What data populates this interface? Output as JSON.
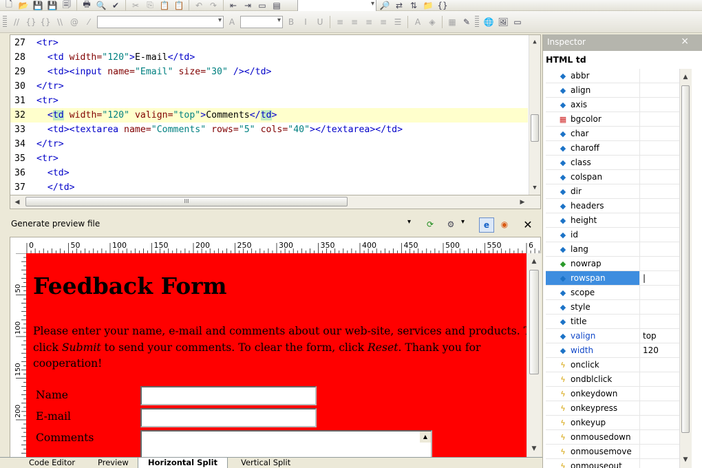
{
  "code_editor": {
    "lines": [
      {
        "num": "27",
        "parts": [
          [
            "tag",
            "<tr>"
          ]
        ]
      },
      {
        "num": "28",
        "parts": [
          [
            "txt",
            "  "
          ],
          [
            "tag",
            "<td "
          ],
          [
            "attr",
            "width="
          ],
          [
            "val",
            "\"120\""
          ],
          [
            "tag",
            ">"
          ],
          [
            "txt",
            "E-mail"
          ],
          [
            "tag",
            "</td>"
          ]
        ]
      },
      {
        "num": "29",
        "parts": [
          [
            "txt",
            "  "
          ],
          [
            "tag",
            "<td><input "
          ],
          [
            "attr",
            "name="
          ],
          [
            "val",
            "\"Email\" "
          ],
          [
            "attr",
            "size="
          ],
          [
            "val",
            "\"30\" "
          ],
          [
            "tag",
            "/></td>"
          ]
        ]
      },
      {
        "num": "30",
        "parts": [
          [
            "tag",
            "</tr>"
          ]
        ]
      },
      {
        "num": "31",
        "parts": [
          [
            "tag",
            "<tr>"
          ]
        ]
      },
      {
        "num": "32",
        "parts": [
          [
            "txt",
            "  "
          ],
          [
            "tag",
            "<"
          ],
          [
            "hl",
            "td"
          ],
          [
            "tag",
            " "
          ],
          [
            "attr",
            "width="
          ],
          [
            "val",
            "\"120\" "
          ],
          [
            "attr",
            "valign="
          ],
          [
            "val",
            "\"top\""
          ],
          [
            "tag",
            ">"
          ],
          [
            "txt",
            "Comments"
          ],
          [
            "tag",
            "</"
          ],
          [
            "hl",
            "td"
          ],
          [
            "tag",
            ">"
          ]
        ]
      },
      {
        "num": "33",
        "parts": [
          [
            "txt",
            "  "
          ],
          [
            "tag",
            "<td><textarea "
          ],
          [
            "attr",
            "name="
          ],
          [
            "val",
            "\"Comments\" "
          ],
          [
            "attr",
            "rows="
          ],
          [
            "val",
            "\"5\" "
          ],
          [
            "attr",
            "cols="
          ],
          [
            "val",
            "\"40\""
          ],
          [
            "tag",
            "></textarea></td>"
          ]
        ]
      },
      {
        "num": "34",
        "parts": [
          [
            "tag",
            "</tr>"
          ]
        ]
      },
      {
        "num": "35",
        "parts": [
          [
            "tag",
            "<tr>"
          ]
        ]
      },
      {
        "num": "36",
        "parts": [
          [
            "txt",
            "  "
          ],
          [
            "tag",
            "<td>"
          ]
        ]
      },
      {
        "num": "37",
        "parts": [
          [
            "txt",
            "  "
          ],
          [
            "tag",
            "</td>"
          ]
        ]
      }
    ],
    "hscroll_grip": "III"
  },
  "preview_toolbar": {
    "label": "Generate preview file",
    "close": "✕"
  },
  "ruler": {
    "labels": [
      "0",
      "50",
      "100",
      "150",
      "200",
      "250",
      "300",
      "350",
      "400",
      "450",
      "500",
      "550",
      "6"
    ],
    "vlabels": [
      "50",
      "100",
      "150",
      "200"
    ]
  },
  "preview": {
    "heading": "Feedback Form",
    "para_1": "Please enter your name, e-mail and comments about our web-site, services and products. Then",
    "para_2a": "click ",
    "para_2b": "Submit",
    "para_2c": " to send your comments. To clear the form, click ",
    "para_2d": "Reset",
    "para_2e": ". Thank you for",
    "para_3": "cooperation!",
    "labels": [
      "Name",
      "E-mail",
      "Comments"
    ],
    "bg_color": "#ff0000"
  },
  "inspector": {
    "title": "Inspector",
    "close": "×",
    "subtitle": "HTML td",
    "attributes": [
      {
        "name": "abbr",
        "icon": "attr-icon",
        "value": ""
      },
      {
        "name": "align",
        "icon": "attr-icon",
        "value": ""
      },
      {
        "name": "axis",
        "icon": "attr-icon",
        "value": ""
      },
      {
        "name": "bgcolor",
        "icon": "color-icon",
        "value": ""
      },
      {
        "name": "char",
        "icon": "attr-icon",
        "value": ""
      },
      {
        "name": "charoff",
        "icon": "attr-icon",
        "value": ""
      },
      {
        "name": "class",
        "icon": "attr-icon",
        "value": ""
      },
      {
        "name": "colspan",
        "icon": "attr-icon",
        "value": ""
      },
      {
        "name": "dir",
        "icon": "attr-icon",
        "value": ""
      },
      {
        "name": "headers",
        "icon": "attr-icon",
        "value": ""
      },
      {
        "name": "height",
        "icon": "attr-icon",
        "value": ""
      },
      {
        "name": "id",
        "icon": "attr-icon",
        "value": ""
      },
      {
        "name": "lang",
        "icon": "attr-icon",
        "value": ""
      },
      {
        "name": "nowrap",
        "icon": "bool-icon",
        "value": ""
      },
      {
        "name": "rowspan",
        "icon": "attr-icon",
        "value": "|"
      },
      {
        "name": "scope",
        "icon": "attr-icon",
        "value": ""
      },
      {
        "name": "style",
        "icon": "attr-icon",
        "value": ""
      },
      {
        "name": "title",
        "icon": "attr-icon",
        "value": ""
      },
      {
        "name": "valign",
        "icon": "attr-icon",
        "value": "top"
      },
      {
        "name": "width",
        "icon": "attr-icon",
        "value": "120"
      },
      {
        "name": "onclick",
        "icon": "event-icon",
        "value": ""
      },
      {
        "name": "ondblclick",
        "icon": "event-icon",
        "value": ""
      },
      {
        "name": "onkeydown",
        "icon": "event-icon",
        "value": ""
      },
      {
        "name": "onkeypress",
        "icon": "event-icon",
        "value": ""
      },
      {
        "name": "onkeyup",
        "icon": "event-icon",
        "value": ""
      },
      {
        "name": "onmousedown",
        "icon": "event-icon",
        "value": ""
      },
      {
        "name": "onmousemove",
        "icon": "event-icon",
        "value": ""
      },
      {
        "name": "onmouseout",
        "icon": "event-icon",
        "value": ""
      }
    ],
    "selected": "rowspan"
  },
  "bottom_tabs": [
    {
      "label": "Code Editor",
      "active": false
    },
    {
      "label": "Preview",
      "active": false
    },
    {
      "label": "Horizontal Split",
      "active": true
    },
    {
      "label": "Vertical Split",
      "active": false
    }
  ],
  "colors": {
    "current_line": "#ffffcc",
    "selection": "#3d8ddf",
    "preview_bg": "#ff0000"
  }
}
